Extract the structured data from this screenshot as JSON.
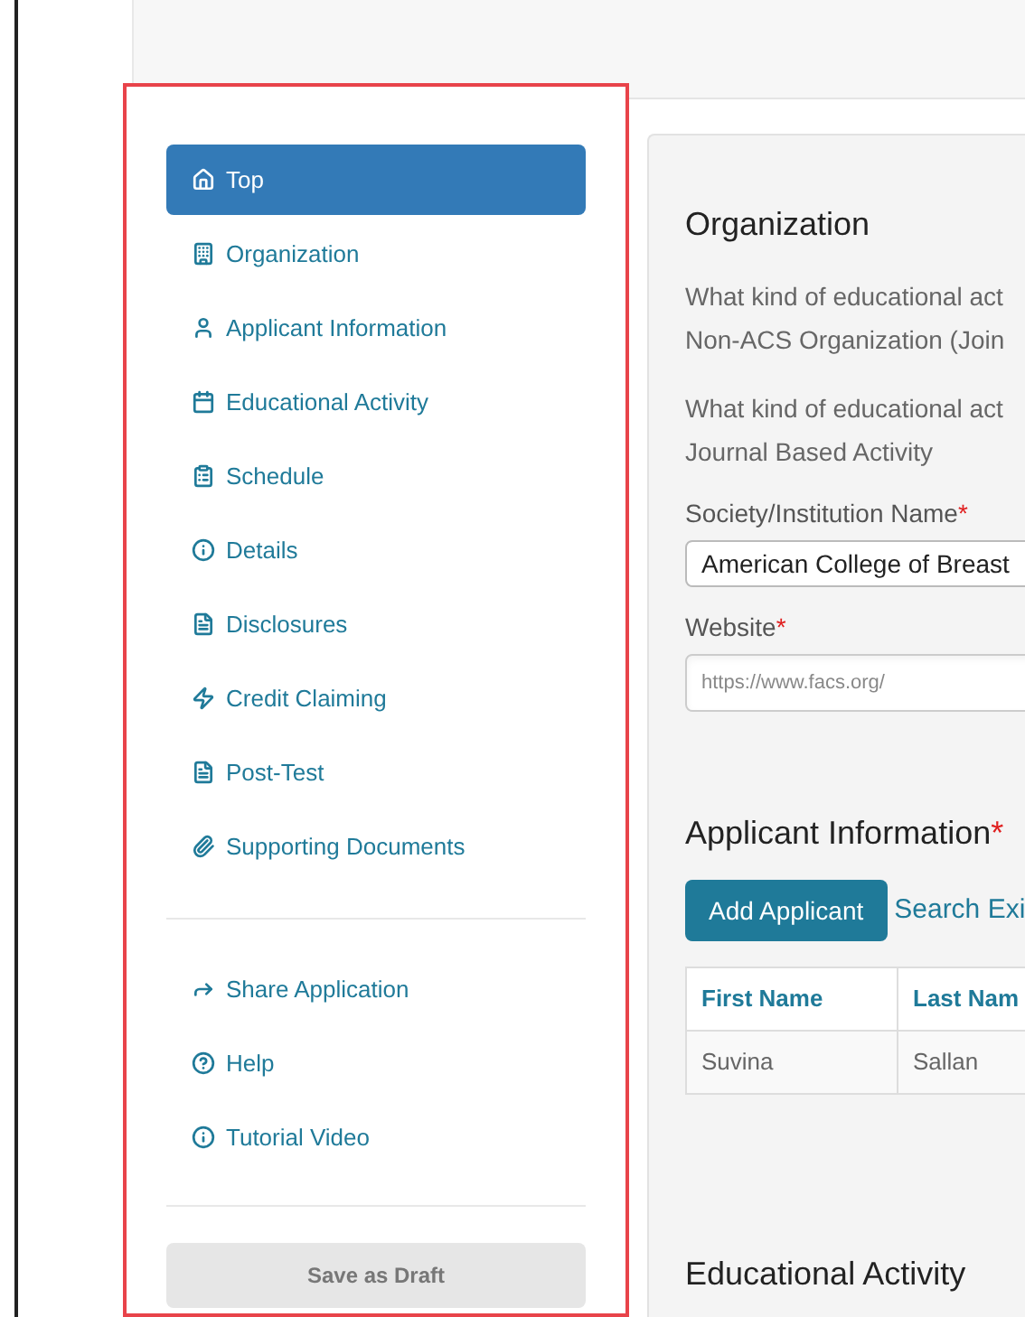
{
  "sidebar": {
    "nav_items": [
      {
        "label": "Top",
        "selected": true
      },
      {
        "label": "Organization",
        "selected": false
      },
      {
        "label": "Applicant Information",
        "selected": false
      },
      {
        "label": "Educational Activity",
        "selected": false
      },
      {
        "label": "Schedule",
        "selected": false
      },
      {
        "label": "Details",
        "selected": false
      },
      {
        "label": "Disclosures",
        "selected": false
      },
      {
        "label": "Credit Claiming",
        "selected": false
      },
      {
        "label": "Post-Test",
        "selected": false
      },
      {
        "label": "Supporting Documents",
        "selected": false
      }
    ],
    "extra_items": [
      {
        "label": "Share Application"
      },
      {
        "label": "Help"
      },
      {
        "label": "Tutorial Video"
      }
    ],
    "save_button": "Save as Draft"
  },
  "organization": {
    "title": "Organization",
    "questions": [
      {
        "question": "What kind of educational act",
        "answer": "Non-ACS Organization (Join"
      },
      {
        "question": "What kind of educational act",
        "answer": "Journal Based Activity"
      }
    ],
    "fields": [
      {
        "label": "Society/Institution Name",
        "required_mark": "*",
        "value": "American College of Breast"
      },
      {
        "label": "Website",
        "required_mark": "*",
        "placeholder": "https://www.facs.org/"
      }
    ]
  },
  "applicant_information": {
    "title": "Applicant Information",
    "required_mark": "*",
    "add_button": "Add Applicant",
    "search_link": "Search Exi",
    "table": {
      "columns": [
        "First Name",
        "Last Nam"
      ],
      "rows": [
        [
          "Suvina",
          "Sallan"
        ]
      ]
    }
  },
  "educational_activity": {
    "title": "Educational Activity"
  }
}
